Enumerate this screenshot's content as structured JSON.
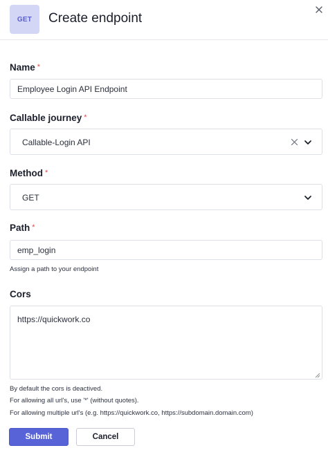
{
  "header": {
    "badge": "GET",
    "title": "Create endpoint",
    "close_icon": "close-icon"
  },
  "form": {
    "name": {
      "label": "Name",
      "required": "*",
      "value": "Employee Login API Endpoint"
    },
    "journey": {
      "label": "Callable journey",
      "required": "*",
      "value": "Callable-Login API",
      "clear_icon": "clear-icon",
      "chevron_icon": "chevron-down-icon"
    },
    "method": {
      "label": "Method",
      "required": "*",
      "value": "GET",
      "chevron_icon": "chevron-down-icon"
    },
    "path": {
      "label": "Path",
      "required": "*",
      "value": "emp_login",
      "hint": "Assign a path to your endpoint"
    },
    "cors": {
      "label": "Cors",
      "value": "https://quickwork.co",
      "notes": [
        "By default the cors is deactived.",
        "For allowing all url's, use '*' (without quotes).",
        "For allowing multiple url's (e.g. https://quickwork.co, https://subdomain.domain.com)"
      ]
    }
  },
  "actions": {
    "submit_label": "Submit",
    "cancel_label": "Cancel"
  },
  "colors": {
    "accent": "#5763d6",
    "badge_bg": "#d4d6f5",
    "required": "#e0484b"
  }
}
